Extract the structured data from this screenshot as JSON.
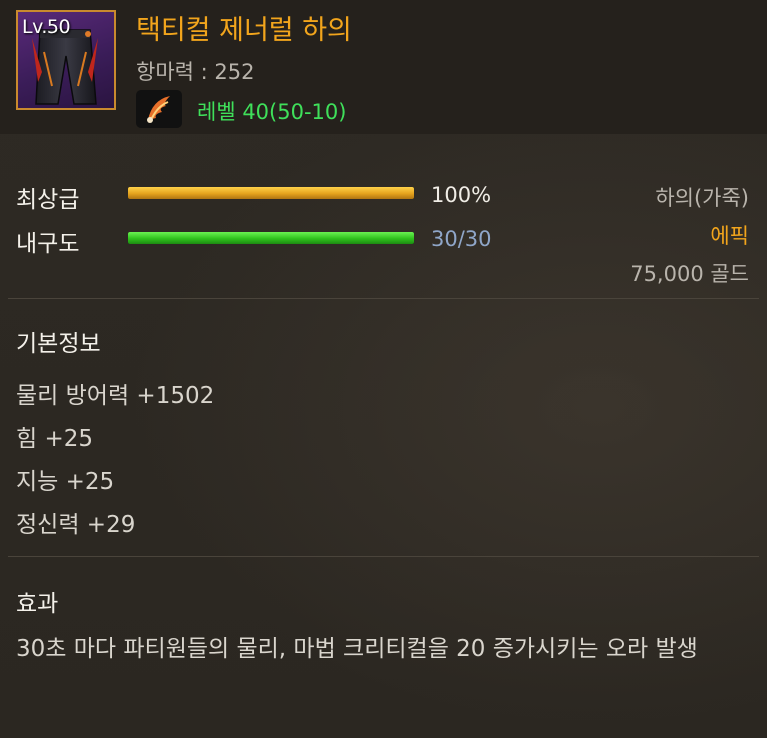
{
  "item": {
    "level_badge": "Lv.50",
    "name": "택티컬 제너럴 하의",
    "anti_magic": "항마력 : 252",
    "required_level": "레벨 40(50-10)",
    "icon": "pants-icon",
    "requirement_icon": "wing-icon"
  },
  "stats": {
    "quality": {
      "label": "최상급",
      "value": "100%",
      "fill": 1.0,
      "color": "#e5a31d"
    },
    "durability": {
      "label": "내구도",
      "value": "30/30",
      "fill": 1.0,
      "color": "#2fc21d"
    }
  },
  "info": {
    "type": "하의(가죽)",
    "rarity": "에픽",
    "rarity_color": "#f2a51c",
    "price": "75,000 골드"
  },
  "basic_info": {
    "title": "기본정보",
    "rows": [
      "물리 방어력 +1502",
      "힘 +25",
      "지능 +25",
      "정신력 +29"
    ]
  },
  "effect": {
    "title": "효과",
    "text": "30초 마다 파티원들의 물리, 마법 크리티컬을 20 증가시키는 오라 발생"
  }
}
